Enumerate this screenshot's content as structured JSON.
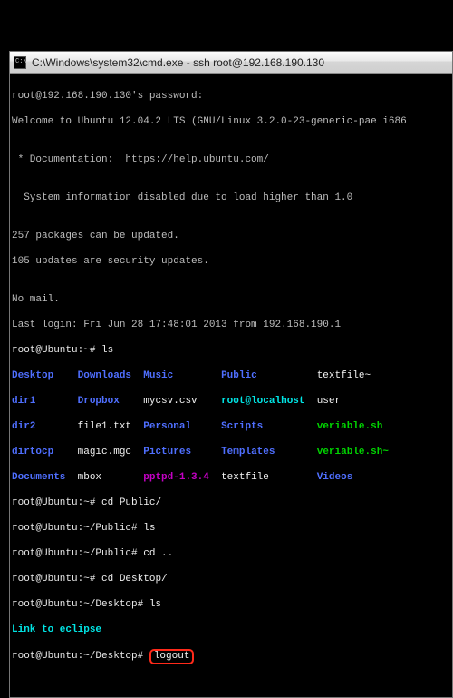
{
  "titlebar": {
    "path": "C:\\Windows\\system32\\cmd.exe",
    "sep": " - ",
    "cmd": "ssh  root@192.168.190.130"
  },
  "lines": {
    "pw": "root@192.168.190.130's password:",
    "welcome": "Welcome to Ubuntu 12.04.2 LTS (GNU/Linux 3.2.0-23-generic-pae i686",
    "blank": "",
    "doc": " * Documentation:  https://help.ubuntu.com/",
    "sysinfo": "  System information disabled due to load higher than 1.0",
    "pkg1": "257 packages can be updated.",
    "pkg2": "105 updates are security updates.",
    "nomail": "No mail.",
    "last": "Last login: Fri Jun 28 17:48:01 2013 from 192.168.190.1"
  },
  "prompts": {
    "home": "root@Ubuntu:~# ",
    "public": "root@Ubuntu:~/Public# ",
    "desktop": "root@Ubuntu:~/Desktop# "
  },
  "cmds": {
    "ls": "ls",
    "cdPublic": "cd Public/",
    "cdUp": "cd ..",
    "cdDesktop": "cd Desktop/",
    "logout": "logout"
  },
  "ls_home": {
    "c1": [
      "Desktop",
      "dir1",
      "dir2",
      "dirtocp",
      "Documents"
    ],
    "c2": [
      "Downloads",
      "Dropbox",
      "file1.txt",
      "magic.mgc",
      "mbox"
    ],
    "c3": [
      "Music",
      "mycsv.csv",
      "Personal",
      "Pictures",
      "pptpd-1.3.4"
    ],
    "c4": [
      "Public",
      "root@localhost",
      "Scripts",
      "Templates",
      "textfile"
    ],
    "c5": [
      "textfile~",
      "user",
      "veriable.sh",
      "veriable.sh~",
      "Videos"
    ]
  },
  "ls_desktop": {
    "linktext": "Link to eclipse"
  }
}
